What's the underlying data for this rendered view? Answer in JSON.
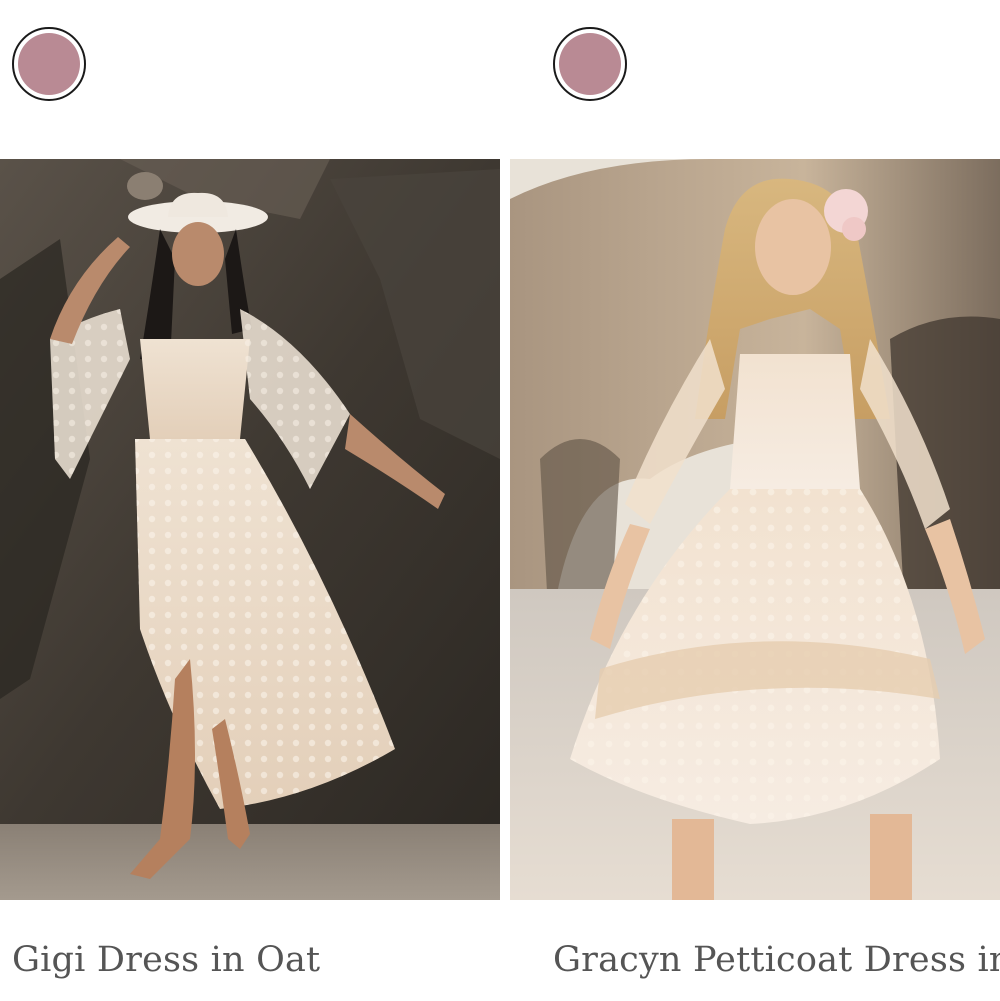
{
  "products": [
    {
      "title": "Gigi Dress in Oat",
      "swatch_color": "#b98a94",
      "image_icon": "model-photo-woman-lace-dress"
    },
    {
      "title": "Gracyn Petticoat Dress in",
      "swatch_color": "#b98a94",
      "image_icon": "model-photo-girl-petticoat-dress"
    }
  ]
}
